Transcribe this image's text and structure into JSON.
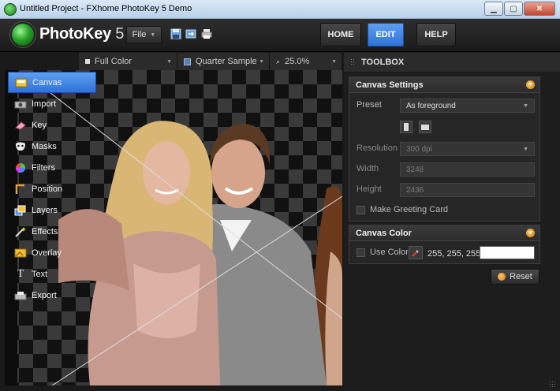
{
  "window": {
    "title": "Untitled Project - FXhome PhotoKey 5 Demo"
  },
  "app": {
    "logo_name": "PhotoKey",
    "logo_version": "5",
    "file_menu": "File"
  },
  "nav": {
    "home": "HOME",
    "edit": "EDIT",
    "help": "HELP",
    "active": "EDIT",
    "accent": "#2f72d7"
  },
  "view_bar": {
    "color_mode": "Full Color",
    "sample": "Quarter Sample",
    "zoom": "25.0%"
  },
  "sidebar": {
    "items": [
      {
        "label": "Canvas",
        "icon": "canvas-icon",
        "active": true
      },
      {
        "label": "Import",
        "icon": "camera-icon",
        "active": false
      },
      {
        "label": "Key",
        "icon": "eraser-icon",
        "active": false
      },
      {
        "label": "Masks",
        "icon": "mask-icon",
        "active": false
      },
      {
        "label": "Filters",
        "icon": "color-wheel-icon",
        "active": false
      },
      {
        "label": "Position",
        "icon": "position-icon",
        "active": false
      },
      {
        "label": "Layers",
        "icon": "layers-icon",
        "active": false
      },
      {
        "label": "Effects",
        "icon": "wand-icon",
        "active": false
      },
      {
        "label": "Overlay",
        "icon": "overlay-icon",
        "active": false
      },
      {
        "label": "Text",
        "icon": "text-icon",
        "active": false
      },
      {
        "label": "Export",
        "icon": "export-icon",
        "active": false
      }
    ]
  },
  "toolbox": {
    "title": "TOOLBOX",
    "canvas_settings": {
      "title": "Canvas Settings",
      "preset_label": "Preset",
      "preset_value": "As foreground",
      "resolution_label": "Resolution",
      "resolution_value": "300 dpi",
      "width_label": "Width",
      "width_value": "3248",
      "height_label": "Height",
      "height_value": "2436",
      "greeting_label": "Make Greeting Card"
    },
    "canvas_color": {
      "title": "Canvas Color",
      "use_color_label": "Use Color",
      "rgb_value": "255, 255, 255",
      "swatch_color": "#ffffff"
    },
    "reset_label": "Reset"
  }
}
